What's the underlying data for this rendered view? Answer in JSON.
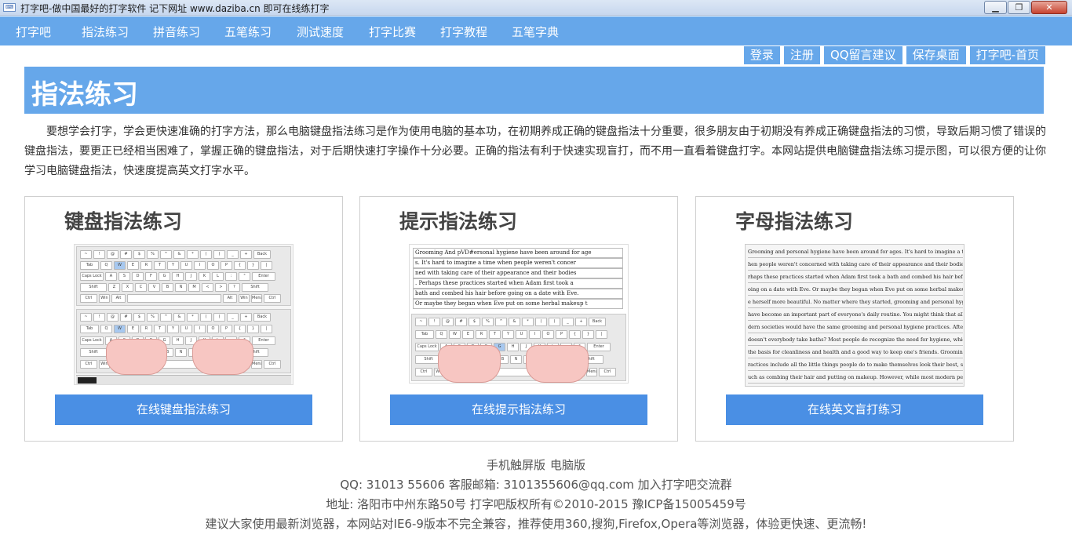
{
  "window": {
    "title": "打字吧-做中国最好的打字软件 记下网址 www.daziba.cn 即可在线练打字",
    "minimize_glyph": "▁",
    "restore_glyph": "❐",
    "close_glyph": "✕"
  },
  "nav": {
    "items": [
      "打字吧",
      "指法练习",
      "拼音练习",
      "五笔练习",
      "测试速度",
      "打字比赛",
      "打字教程",
      "五笔字典"
    ]
  },
  "sublinks": [
    "登录",
    "注册",
    "QQ留言建议",
    "保存桌面",
    "打字吧-首页"
  ],
  "banner": {
    "title": "指法练习"
  },
  "intro": "要想学会打字，学会更快速准确的打字方法，那么电脑键盘指法练习是作为使用电脑的基本功，在初期养成正确的键盘指法十分重要，很多朋友由于初期没有养成正确键盘指法的习惯，导致后期习惯了错误的键盘指法，要更正已经相当困难了，掌握正确的键盘指法，对于后期快速打字操作十分必要。正确的指法有利于快速实现盲打，而不用一直看着键盘打字。本网站提供电脑键盘指法练习提示图，可以很方便的让你学习电脑键盘指法，快速度提高英文打字水平。",
  "cards": [
    {
      "title": "键盘指法练习",
      "button": "在线键盘指法练习"
    },
    {
      "title": "提示指法练习",
      "button": "在线提示指法练习"
    },
    {
      "title": "字母指法练习",
      "button": "在线英文盲打练习"
    }
  ],
  "card2_lines": [
    "Grooming And pVD#ersonal hygiene have been around for age",
    "s. It's hard to imagine a time when people weren't concer",
    "ned with taking care of their appearance and their bodies",
    ". Perhaps these practices started when Adam first took a",
    "bath and combed his hair before going on a date with Eve.",
    "Or maybe they began when Eve put on some herbal makeup t"
  ],
  "card3_lines": [
    "Grooming and personal hygiene have been around for ages. It's hard to imagine a time w",
    "hen people weren't concerned with taking care of their appearance and their bodies. Pe",
    "rhaps these practices started when Adam first took a bath and combed his hair before g",
    "oing on a date with Eve. Or maybe they began when Eve put on some herbal makeup to mak",
    "e herself more beautiful. No matter where they started, grooming and personal hygiene",
    "have become an important part of everyone's daily routine. You might think that all mo",
    "dern societies would have the same grooming and personal hygiene practices. After all,",
    "doesn't everybody take baths? Most people do recognize the need for hygiene, which is",
    "the basis for cleanliness and health and a good way to keep one's friends. Grooming p",
    "ractices include all the little things people do to make themselves look their best, s",
    "uch as combing their hair and putting on makeup. However, while most modern people agr"
  ],
  "footer": {
    "mobile": "手机触屏版",
    "desktop": "电脑版",
    "contact": "QQ: 31013 55606 客服邮箱: 3101355606@qq.com 加入打字吧交流群",
    "address": "地址: 洛阳市中州东路50号 打字吧版权所有©2010-2015 豫ICP备15005459号",
    "browser_tip": "建议大家使用最新浏览器，本网站对IE6-9版本不完全兼容，推荐使用360,搜狗,Firefox,Opera等浏览器，体验更快速、更流畅!"
  },
  "keyboard_rows": [
    [
      "~",
      "!",
      "@",
      "#",
      "$",
      "%",
      "^",
      "&",
      "*",
      "(",
      ")",
      "_",
      "+",
      "Back"
    ],
    [
      "Tab",
      "Q",
      "W",
      "E",
      "R",
      "T",
      "Y",
      "U",
      "I",
      "O",
      "P",
      "{",
      "}",
      "|"
    ],
    [
      "Caps Lock",
      "A",
      "S",
      "D",
      "F",
      "G",
      "H",
      "J",
      "K",
      "L",
      ":",
      "\"",
      "Enter"
    ],
    [
      "Shift",
      "Z",
      "X",
      "C",
      "V",
      "B",
      "N",
      "M",
      "<",
      ">",
      "?",
      "Shift"
    ],
    [
      "Ctrl",
      "Win",
      "Alt",
      "",
      "Alt",
      "Win",
      "Menu",
      "Ctrl"
    ]
  ],
  "colors": {
    "accent": "#66a7ea",
    "button": "#4a8fe4",
    "highlight_key": "#a7c8ef",
    "hand": "#f7c6c2"
  }
}
